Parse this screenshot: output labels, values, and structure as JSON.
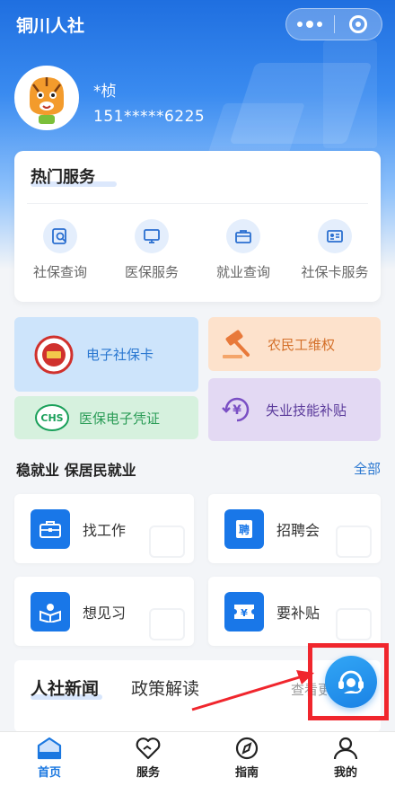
{
  "app": {
    "title": "铜川人社"
  },
  "user": {
    "name": "*桢",
    "phone": "151*****6225"
  },
  "hot_services": {
    "title": "热门服务",
    "items": [
      {
        "label": "社保查询",
        "icon": "search-document-icon"
      },
      {
        "label": "医保服务",
        "icon": "monitor-icon"
      },
      {
        "label": "就业查询",
        "icon": "briefcase-icon"
      },
      {
        "label": "社保卡服务",
        "icon": "id-card-icon"
      }
    ]
  },
  "feature_tiles": {
    "social_security_card": "电子社保卡",
    "migrant_rights": "农民工维权",
    "medical_voucher": "医保电子凭证",
    "unemployment_subsidy": "失业技能补贴",
    "chs_badge": "CHS"
  },
  "employment": {
    "title": "稳就业 保居民就业",
    "all_label": "全部",
    "items": [
      {
        "label": "找工作",
        "icon": "briefcase-icon"
      },
      {
        "label": "招聘会",
        "icon": "hire-icon",
        "icon_text": "聘"
      },
      {
        "label": "想见习",
        "icon": "book-person-icon"
      },
      {
        "label": "要补贴",
        "icon": "ticket-icon",
        "icon_text": "¥"
      }
    ]
  },
  "news": {
    "tab_active": "人社新闻",
    "tab_other": "政策解读",
    "more": "查看更"
  },
  "bottom_nav": [
    {
      "label": "首页",
      "icon": "home-icon",
      "active": true
    },
    {
      "label": "服务",
      "icon": "heart-icon",
      "active": false
    },
    {
      "label": "指南",
      "icon": "compass-icon",
      "active": false
    },
    {
      "label": "我的",
      "icon": "user-icon",
      "active": false
    }
  ],
  "colors": {
    "primary": "#1a77e0",
    "annotation": "#f0262d"
  }
}
